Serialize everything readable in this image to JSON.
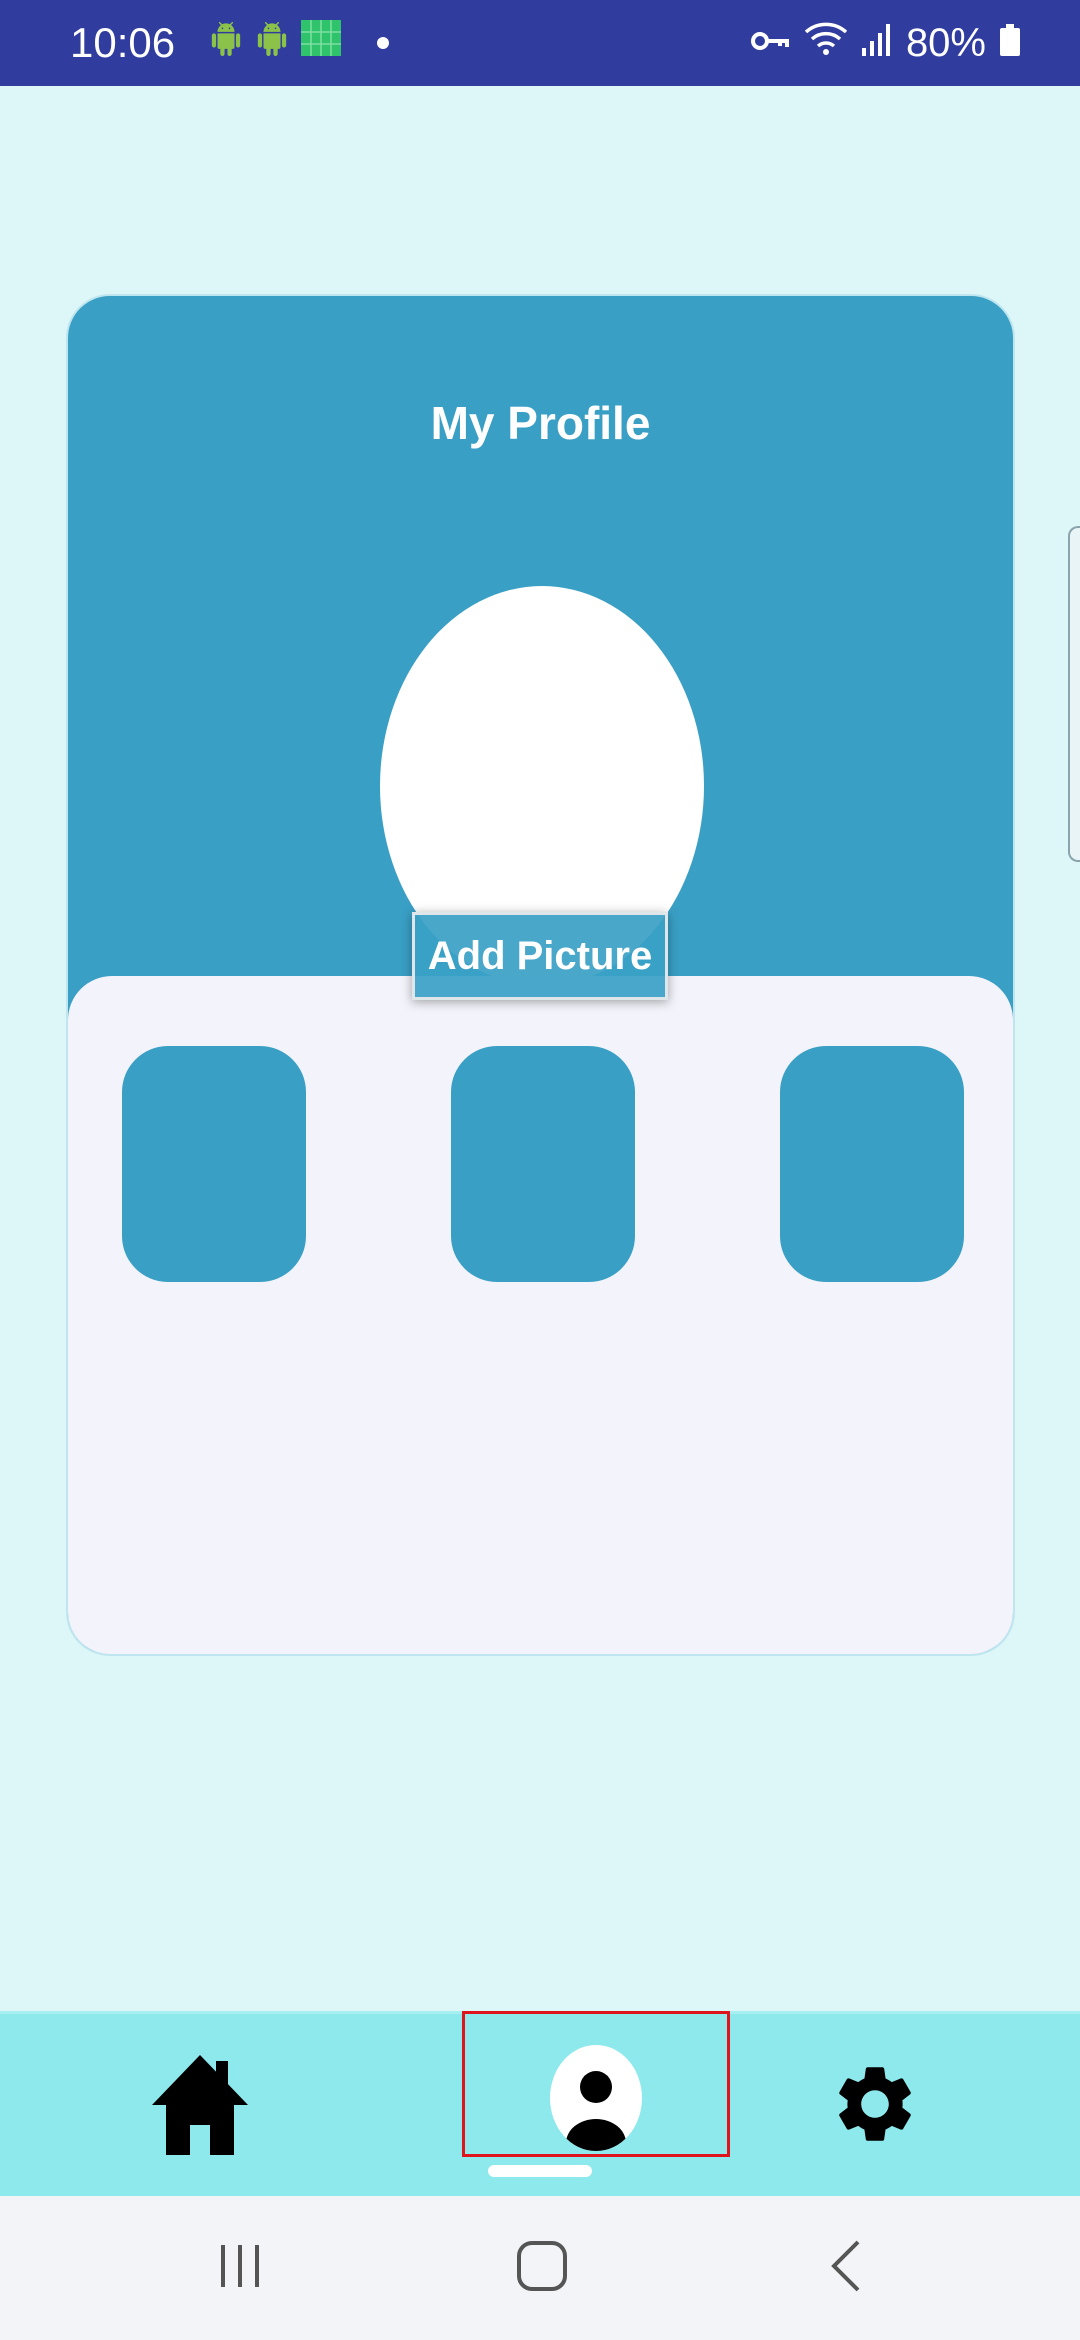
{
  "status_bar": {
    "time": "10:06",
    "battery_percent": "80%",
    "icons_left": [
      "android-icon",
      "android-icon",
      "app-grid-icon",
      "dot"
    ],
    "icons_right": [
      "vpn-key-icon",
      "wifi-icon",
      "signal-icon",
      "battery-icon"
    ]
  },
  "profile_card": {
    "title": "My Profile",
    "add_picture_label": "Add Picture",
    "tile_count": 3
  },
  "bottom_tabs": [
    {
      "name": "home",
      "icon": "home-icon"
    },
    {
      "name": "profile",
      "icon": "profile-avatar-icon",
      "selected": true
    },
    {
      "name": "settings",
      "icon": "gear-icon"
    }
  ],
  "system_nav": [
    "recents",
    "home",
    "back"
  ],
  "colors": {
    "status_bar": "#303c9e",
    "background": "#ddf7f8",
    "card_accent": "#3a9fc5",
    "card_bottom": "#f3f4fb",
    "tab_bar": "#8de9eb",
    "highlight": "#e0141c"
  }
}
